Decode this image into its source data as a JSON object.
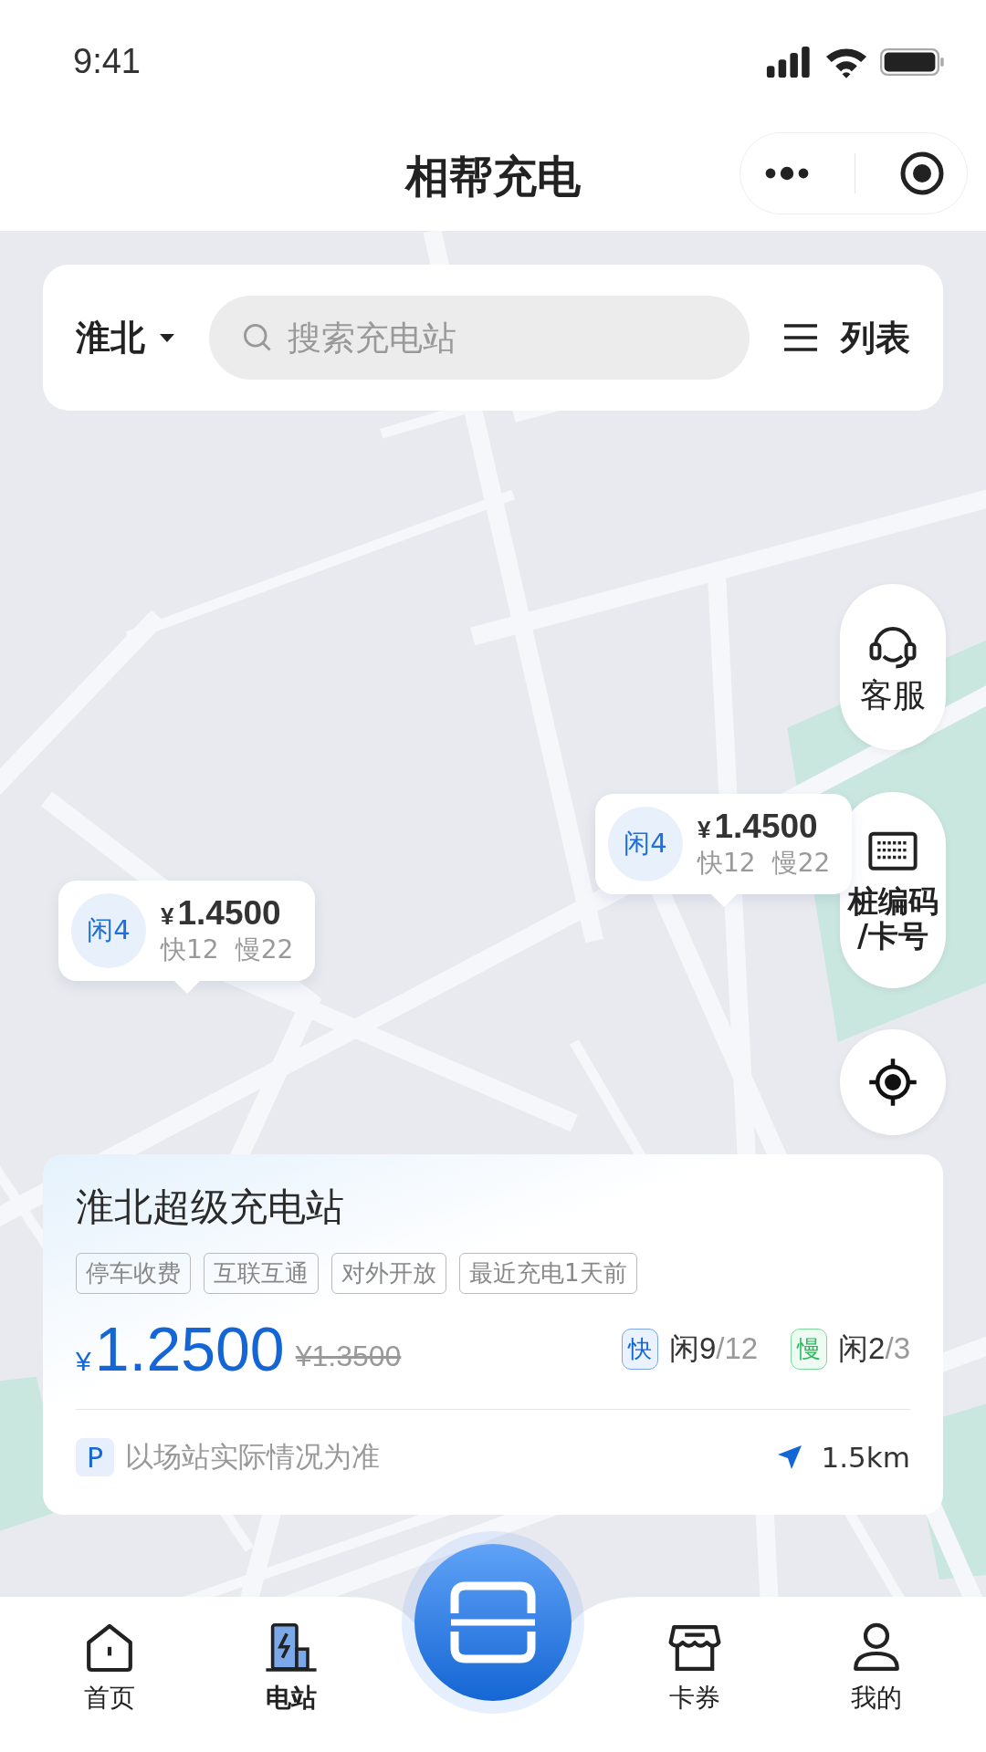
{
  "status_bar": {
    "time": "9:41"
  },
  "nav_bar": {
    "title": "相帮充电"
  },
  "search_bar": {
    "city": "淮北",
    "placeholder": "搜索充电站",
    "list_label": "列表"
  },
  "side_buttons": [
    {
      "kind": "service",
      "label": "客服"
    },
    {
      "kind": "code",
      "label": "桩编码\n/卡号"
    },
    {
      "kind": "locate"
    }
  ],
  "markers": [
    {
      "free": "闲4",
      "currency": "¥",
      "price": "1.4500",
      "fast": "快12",
      "slow": "慢22"
    },
    {
      "free": "闲4",
      "currency": "¥",
      "price": "1.4500",
      "fast": "快12",
      "slow": "慢22"
    }
  ],
  "station_card": {
    "name": "淮北超级充电站",
    "tags": [
      "停车收费",
      "互联互通",
      "对外开放",
      "最近充电1天前"
    ],
    "currency": "¥",
    "price": "1.2500",
    "original_price": "¥1.3500",
    "chargers": [
      {
        "kind": "fast",
        "badge": "快",
        "free": "闲9",
        "total": "/12"
      },
      {
        "kind": "slow",
        "badge": "慢",
        "free": "闲2",
        "total": "/3"
      }
    ],
    "parking_badge": "P",
    "note": "以场站实际情况为准",
    "distance": "1.5km"
  },
  "tab_bar": {
    "items": [
      {
        "kind": "home",
        "label": "首页",
        "selected": false
      },
      {
        "kind": "station",
        "label": "电站",
        "selected": true
      },
      {
        "kind": "scan"
      },
      {
        "kind": "coupon",
        "label": "卡券",
        "selected": false
      },
      {
        "kind": "profile",
        "label": "我的",
        "selected": false
      }
    ]
  }
}
